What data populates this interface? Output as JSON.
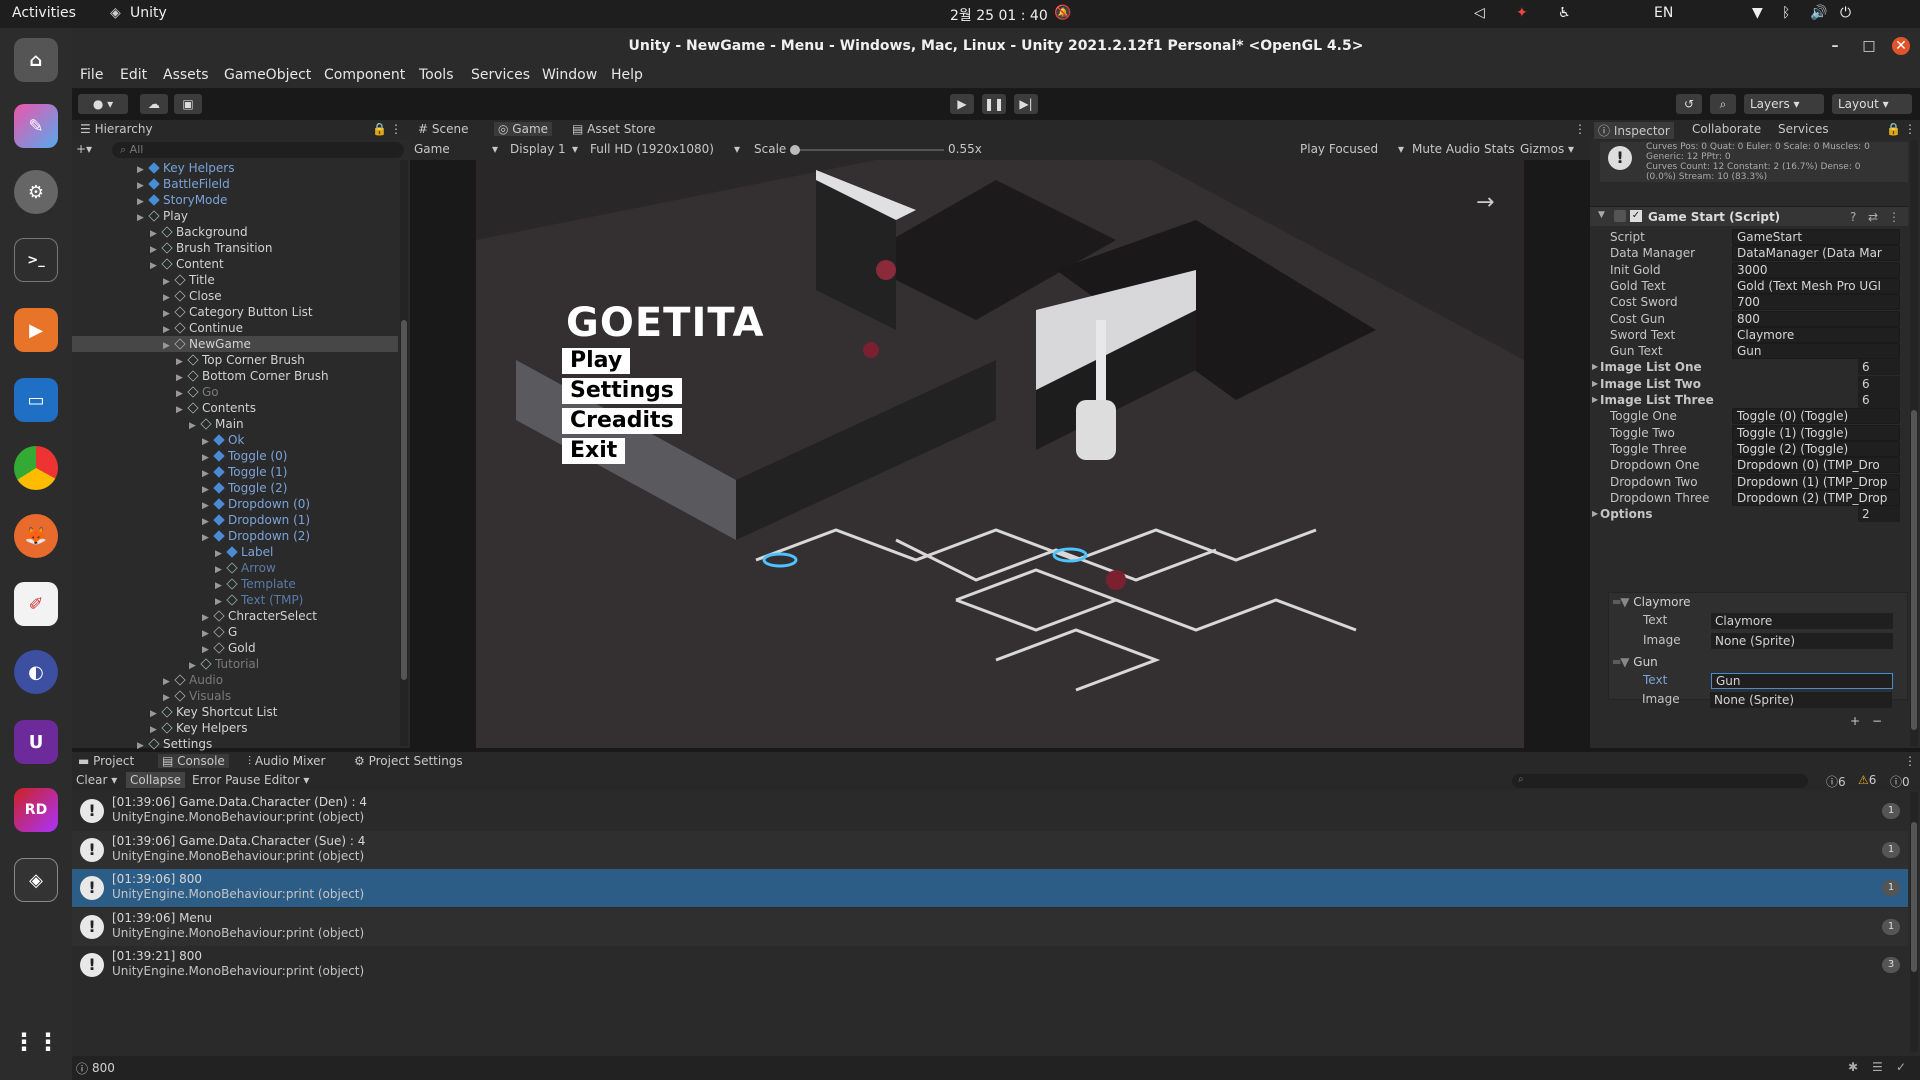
{
  "os": {
    "activities": "Activities",
    "app_name": "Unity",
    "clock": "2월 25 01 : 40",
    "lang": "EN"
  },
  "window": {
    "title": "Unity - NewGame - Menu - Windows, Mac, Linux - Unity 2021.2.12f1 Personal* <OpenGL 4.5>"
  },
  "menu": [
    "File",
    "Edit",
    "Assets",
    "GameObject",
    "Component",
    "Tools",
    "Services",
    "Window",
    "Help"
  ],
  "toolbar": {
    "layers": "Layers",
    "layout": "Layout"
  },
  "hierarchy": {
    "tab": "Hierarchy",
    "search_placeholder": "All",
    "rows": [
      {
        "label": "Key Helpers",
        "indent": 5,
        "style": "blue"
      },
      {
        "label": "BattleFileld",
        "indent": 5,
        "style": "blue"
      },
      {
        "label": "StoryMode",
        "indent": 5,
        "style": "blue"
      },
      {
        "label": "Play",
        "indent": 5,
        "style": "normal"
      },
      {
        "label": "Background",
        "indent": 6,
        "style": "normal"
      },
      {
        "label": "Brush Transition",
        "indent": 6,
        "style": "normal"
      },
      {
        "label": "Content",
        "indent": 6,
        "style": "normal"
      },
      {
        "label": "Title",
        "indent": 7,
        "style": "normal"
      },
      {
        "label": "Close",
        "indent": 7,
        "style": "normal"
      },
      {
        "label": "Category Button List",
        "indent": 7,
        "style": "normal"
      },
      {
        "label": "Continue",
        "indent": 7,
        "style": "normal"
      },
      {
        "label": "NewGame",
        "indent": 7,
        "style": "sel"
      },
      {
        "label": "Top Corner Brush",
        "indent": 8,
        "style": "normal"
      },
      {
        "label": "Bottom Corner Brush",
        "indent": 8,
        "style": "normal"
      },
      {
        "label": "Go",
        "indent": 8,
        "style": "dim"
      },
      {
        "label": "Contents",
        "indent": 8,
        "style": "normal"
      },
      {
        "label": "Main",
        "indent": 9,
        "style": "normal"
      },
      {
        "label": "Ok",
        "indent": 10,
        "style": "blue"
      },
      {
        "label": "Toggle (0)",
        "indent": 10,
        "style": "blue"
      },
      {
        "label": "Toggle (1)",
        "indent": 10,
        "style": "blue"
      },
      {
        "label": "Toggle (2)",
        "indent": 10,
        "style": "blue"
      },
      {
        "label": "Dropdown (0)",
        "indent": 10,
        "style": "blue"
      },
      {
        "label": "Dropdown (1)",
        "indent": 10,
        "style": "blue"
      },
      {
        "label": "Dropdown (2)",
        "indent": 10,
        "style": "blue"
      },
      {
        "label": "Label",
        "indent": 11,
        "style": "blue"
      },
      {
        "label": "Arrow",
        "indent": 11,
        "style": "dimblue"
      },
      {
        "label": "Template",
        "indent": 11,
        "style": "dimblue"
      },
      {
        "label": "Text (TMP)",
        "indent": 11,
        "style": "dimblue"
      },
      {
        "label": "ChracterSelect",
        "indent": 10,
        "style": "normal"
      },
      {
        "label": "G",
        "indent": 10,
        "style": "normal"
      },
      {
        "label": "Gold",
        "indent": 10,
        "style": "normal"
      },
      {
        "label": "Tutorial",
        "indent": 9,
        "style": "dim"
      },
      {
        "label": "Audio",
        "indent": 7,
        "style": "dim"
      },
      {
        "label": "Visuals",
        "indent": 7,
        "style": "dim"
      },
      {
        "label": "Key Shortcut List",
        "indent": 6,
        "style": "normal"
      },
      {
        "label": "Key Helpers",
        "indent": 6,
        "style": "normal"
      },
      {
        "label": "Settings",
        "indent": 5,
        "style": "normal"
      }
    ]
  },
  "views": {
    "scene_tab": "Scene",
    "game_tab": "Game",
    "store_tab": "Asset Store",
    "game_dropdown": "Game",
    "display": "Display 1",
    "resolution": "Full HD (1920x1080)",
    "scale_label": "Scale",
    "scale_value": "0.55x",
    "play_focused": "Play Focused",
    "mute": "Mute Audio",
    "stats": "Stats",
    "gizmos": "Gizmos"
  },
  "game": {
    "title": "GOETITA",
    "items": [
      "Play",
      "Settings",
      "Creadits",
      "Exit"
    ]
  },
  "inspector": {
    "tabs": [
      "Inspector",
      "Collaborate",
      "Services"
    ],
    "info_line1": "Curves Pos: 0 Quat: 0 Euler: 0 Scale: 0 Muscles: 0",
    "info_line2": "Generic: 12 PPtr: 0",
    "info_line3": "Curves Count: 12 Constant: 2 (16.7%) Dense: 0",
    "info_line4": "(0.0%) Stream: 10 (83.3%)",
    "component": "Game Start (Script)",
    "fields": [
      {
        "label": "Script",
        "value": "GameStart",
        "kind": "ref"
      },
      {
        "label": "Data Manager",
        "value": "DataManager (Data Mar",
        "kind": "ref"
      },
      {
        "label": "Init Gold",
        "value": "3000",
        "kind": "text"
      },
      {
        "label": "Gold Text",
        "value": "Gold (Text Mesh Pro UGI",
        "kind": "ref"
      },
      {
        "label": "Cost Sword",
        "value": "700",
        "kind": "text"
      },
      {
        "label": "Cost Gun",
        "value": "800",
        "kind": "text"
      },
      {
        "label": "Sword Text",
        "value": "Claymore",
        "kind": "text"
      },
      {
        "label": "Gun Text",
        "value": "Gun",
        "kind": "text"
      },
      {
        "label": "Image List One",
        "value": "6",
        "kind": "list"
      },
      {
        "label": "Image List Two",
        "value": "6",
        "kind": "list"
      },
      {
        "label": "Image List Three",
        "value": "6",
        "kind": "list"
      },
      {
        "label": "Toggle One",
        "value": "Toggle (0) (Toggle)",
        "kind": "ref"
      },
      {
        "label": "Toggle Two",
        "value": "Toggle (1) (Toggle)",
        "kind": "ref"
      },
      {
        "label": "Toggle Three",
        "value": "Toggle (2) (Toggle)",
        "kind": "ref"
      },
      {
        "label": "Dropdown One",
        "value": "Dropdown (0) (TMP_Dro",
        "kind": "ref"
      },
      {
        "label": "Dropdown Two",
        "value": "Dropdown (1) (TMP_Drop",
        "kind": "ref"
      },
      {
        "label": "Dropdown Three",
        "value": "Dropdown (2) (TMP_Drop",
        "kind": "ref"
      },
      {
        "label": "Options",
        "value": "2",
        "kind": "list"
      }
    ],
    "options": [
      {
        "name": "Claymore",
        "text_label": "Text",
        "text": "Claymore",
        "image_label": "Image",
        "image": "None (Sprite)"
      },
      {
        "name": "Gun",
        "text_label": "Text",
        "text": "Gun",
        "image_label": "Image",
        "image": "None (Sprite)"
      }
    ]
  },
  "bottom": {
    "tabs": [
      "Project",
      "Console",
      "Audio Mixer",
      "Project Settings"
    ],
    "clear": "Clear",
    "collapse": "Collapse",
    "error_pause": "Error Pause",
    "editor": "Editor",
    "counts": {
      "info": "6",
      "warn": "6",
      "error": "0"
    },
    "logs": [
      {
        "line1": "[01:39:06] Game.Data.Character (Den) : 4",
        "line2": "UnityEngine.MonoBehaviour:print (object)",
        "count": "1",
        "selected": false
      },
      {
        "line1": "[01:39:06] Game.Data.Character (Sue) : 4",
        "line2": "UnityEngine.MonoBehaviour:print (object)",
        "count": "1",
        "selected": false
      },
      {
        "line1": "[01:39:06] 800",
        "line2": "UnityEngine.MonoBehaviour:print (object)",
        "count": "1",
        "selected": true
      },
      {
        "line1": "[01:39:06] Menu",
        "line2": "UnityEngine.MonoBehaviour:print (object)",
        "count": "1",
        "selected": false
      },
      {
        "line1": "[01:39:21] 800",
        "line2": "UnityEngine.MonoBehaviour:print (object)",
        "count": "3",
        "selected": false
      }
    ],
    "status": "800"
  },
  "colors": {
    "selection": "#2c5d87",
    "accent": "#4a8bd6"
  }
}
